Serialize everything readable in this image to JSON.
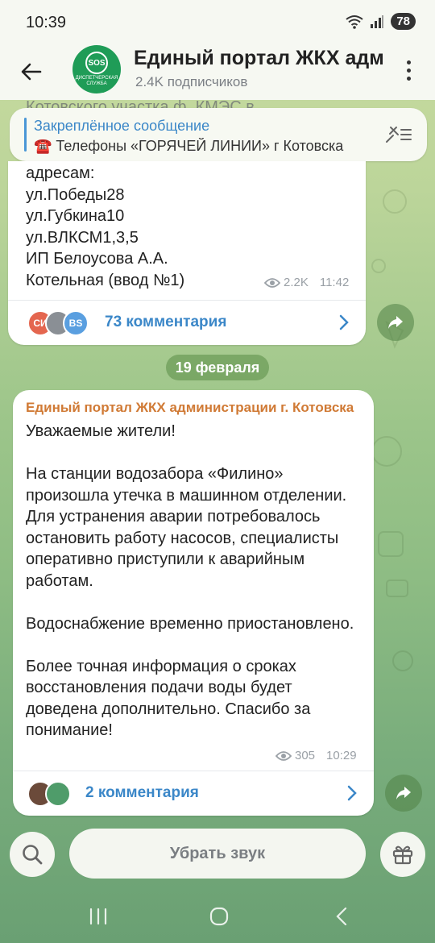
{
  "status_bar": {
    "time": "10:39",
    "battery": "78"
  },
  "header": {
    "title": "Единый портал ЖКХ администрации г. Котовска",
    "subscribers": "2.4K подписчиков",
    "avatar_sos": "SOS",
    "avatar_caption": "ДИСПЕТЧЕРСКАЯ СЛУЖБА"
  },
  "background_peek": "Котовского участка ф. КМЭС в",
  "pinned": {
    "label": "Закреплённое сообщение",
    "text": "☎️ Телефоны «ГОРЯЧЕЙ ЛИНИИ» г Котовска"
  },
  "message1": {
    "body": "адресам:\nул.Победы28\nул.Губкина10\nул.ВЛКСМ1,3,5\nИП Белоусова А.А.\nКотельная  (ввод №1)",
    "views": "2.2K",
    "time": "11:42",
    "comment_avatars": [
      "СИ",
      "",
      "BS"
    ],
    "comments_label": "73 комментария"
  },
  "date_separator": "19 февраля",
  "message2": {
    "sender": "Единый портал ЖКХ администрации г. Котовска",
    "body": "Уважаемые жители!\n\nНа станции водозабора «Филино» произошла утечка в машинном отделении. Для устранения аварии потребовалось остановить работу насосов, специалисты оперативно приступили к аварийным работам.\n\nВодоснабжение временно приостановлено.\n\nБолее точная информация о сроках восстановления подачи воды будет доведена дополнительно. Спасибо за понимание!",
    "views": "305",
    "time": "10:29",
    "comments_label": "2 комментария"
  },
  "bottom_bar": {
    "mute_label": "Убрать звук"
  },
  "colors": {
    "accent": "#3b87c8",
    "sender": "#d07a35",
    "avatar": "#1f9c57"
  }
}
